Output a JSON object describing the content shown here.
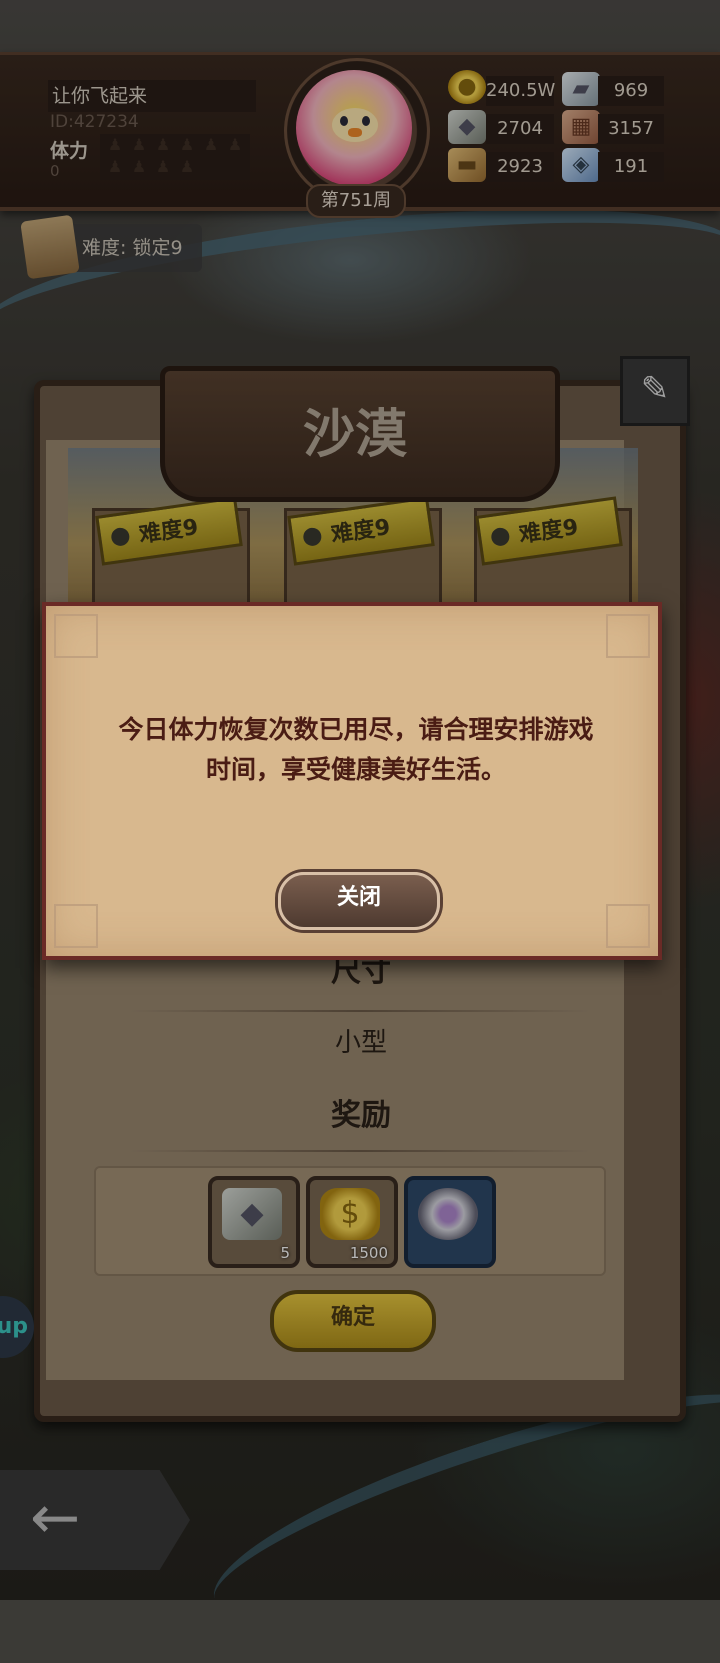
{
  "player": {
    "name": "让你飞起来",
    "id": "ID:427234",
    "stamina_label": "体力",
    "stamina_value": "0",
    "week": "第751周"
  },
  "resources": [
    {
      "icon": "gold-coin-icon",
      "value": "240.5W"
    },
    {
      "icon": "silver-ingot-icon",
      "value": "969"
    },
    {
      "icon": "stone-icon",
      "value": "2704"
    },
    {
      "icon": "brick-icon",
      "value": "3157"
    },
    {
      "icon": "wood-log-icon",
      "value": "2923"
    },
    {
      "icon": "crystal-icon",
      "value": "191"
    }
  ],
  "difficulty_tag": "难度: 锁定9",
  "panel": {
    "title": "沙漠",
    "cards": [
      "难度9",
      "难度9",
      "难度9"
    ],
    "size_label": "尺寸",
    "size_value": "小型",
    "reward_label": "奖励",
    "rewards": [
      {
        "icon": "ore-icon",
        "qty": "5"
      },
      {
        "icon": "gold-bag-icon",
        "qty": "1500"
      },
      {
        "icon": "ring-icon",
        "qty": ""
      }
    ],
    "confirm_label": "确定"
  },
  "dialog": {
    "line1": "今日体力恢复次数已用尽，请合理安排游戏",
    "line2": "时间，享受健康美好生活。",
    "close_label": "关闭"
  },
  "side_fab_label": "up",
  "back_icon": "←"
}
